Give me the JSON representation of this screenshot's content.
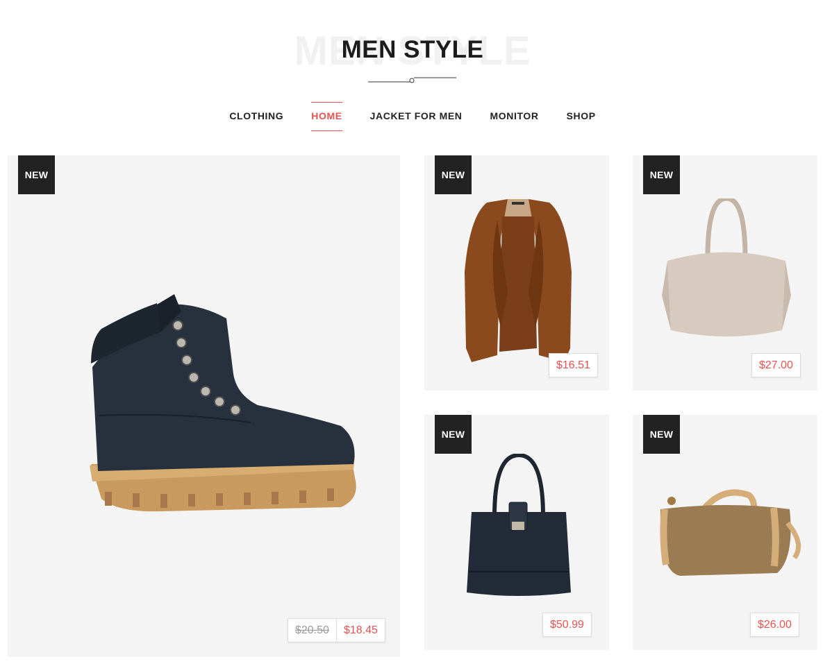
{
  "header": {
    "background_text": "MEN STYLE",
    "title": "MEN STYLE"
  },
  "nav": {
    "items": [
      {
        "label": "CLOTHING",
        "active": false
      },
      {
        "label": "HOME",
        "active": true
      },
      {
        "label": "JACKET FOR MEN",
        "active": false
      },
      {
        "label": "MONITOR",
        "active": false
      },
      {
        "label": "SHOP",
        "active": false
      }
    ]
  },
  "products": [
    {
      "badge": "NEW",
      "image": "boot-icon",
      "old_price": "$20.50",
      "price": "$18.45"
    },
    {
      "badge": "NEW",
      "image": "jacket-icon",
      "price": "$16.51"
    },
    {
      "badge": "NEW",
      "image": "tote-bag-icon",
      "price": "$27.00"
    },
    {
      "badge": "NEW",
      "image": "handbag-icon",
      "price": "$50.99"
    },
    {
      "badge": "NEW",
      "image": "duffel-bag-icon",
      "price": "$26.00"
    }
  ],
  "colors": {
    "accent": "#e8524f",
    "badge_bg": "#222222",
    "card_bg": "#f4f4f5",
    "text": "#1f1f1f"
  }
}
